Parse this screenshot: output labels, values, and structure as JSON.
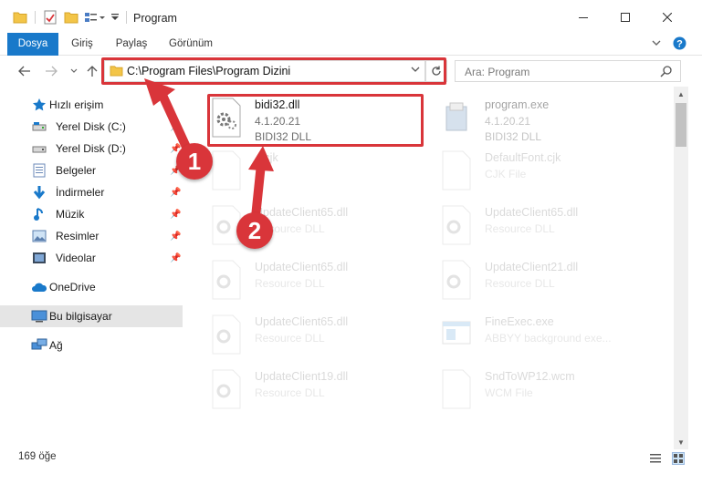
{
  "window": {
    "title": "Program",
    "minimize_label": "—",
    "maximize_label": "☐",
    "close_label": "✕"
  },
  "ribbon": {
    "tabs": [
      {
        "label": "Dosya",
        "active": true
      },
      {
        "label": "Giriş"
      },
      {
        "label": "Paylaş"
      },
      {
        "label": "Görünüm"
      }
    ]
  },
  "navigation": {
    "address": "C:\\Program Files\\Program Dizini",
    "search_placeholder": "Ara: Program"
  },
  "sidebar": {
    "items": [
      {
        "label": "Hızlı erişim",
        "icon": "star-icon"
      },
      {
        "label": "Yerel Disk (C:)",
        "icon": "drive-icon",
        "pinned": true
      },
      {
        "label": "Yerel Disk (D:)",
        "icon": "drive-icon",
        "pinned": true
      },
      {
        "label": "Belgeler",
        "icon": "document-icon",
        "pinned": true
      },
      {
        "label": "İndirmeler",
        "icon": "download-icon",
        "pinned": true
      },
      {
        "label": "Müzik",
        "icon": "music-icon",
        "pinned": true
      },
      {
        "label": "Resimler",
        "icon": "pictures-icon",
        "pinned": true
      },
      {
        "label": "Videolar",
        "icon": "video-icon",
        "pinned": true
      },
      {
        "label": "OneDrive",
        "icon": "cloud-icon"
      },
      {
        "label": "Bu bilgisayar",
        "icon": "computer-icon",
        "selected": true
      },
      {
        "label": "Ağ",
        "icon": "network-icon"
      }
    ]
  },
  "files": [
    {
      "name": "bidi32.dll",
      "line1": "4.1.20.21",
      "line2": "BIDI32 DLL",
      "icon": "dll-gear-icon",
      "highlighted": true
    },
    {
      "name": "program.exe",
      "line1": "4.1.20.21",
      "line2": "BIDI32 DLL",
      "icon": "installer-icon"
    },
    {
      "name": "...cjk",
      "line1": "",
      "line2": "",
      "icon": "blank-file-icon"
    },
    {
      "name": "DefaultFont.cjk",
      "line1": "CJK File",
      "line2": "",
      "icon": "blank-file-icon"
    },
    {
      "name": "UpdateClient65.dll",
      "line1": "Resource DLL",
      "line2": "",
      "icon": "dll-gear-icon"
    },
    {
      "name": "UpdateClient65.dll",
      "line1": "Resource DLL",
      "line2": "",
      "icon": "dll-gear-icon"
    },
    {
      "name": "UpdateClient65.dll",
      "line1": "Resource DLL",
      "line2": "",
      "icon": "dll-gear-icon"
    },
    {
      "name": "UpdateClient21.dll",
      "line1": "Resource DLL",
      "line2": "",
      "icon": "dll-gear-icon"
    },
    {
      "name": "UpdateClient65.dll",
      "line1": "Resource DLL",
      "line2": "",
      "icon": "dll-gear-icon"
    },
    {
      "name": "FineExec.exe",
      "line1": "ABBYY background exe...",
      "line2": "",
      "icon": "app-window-icon"
    },
    {
      "name": "UpdateClient19.dll",
      "line1": "Resource DLL",
      "line2": "",
      "icon": "dll-gear-icon"
    },
    {
      "name": "SndToWP12.wcm",
      "line1": "WCM File",
      "line2": "",
      "icon": "blank-file-icon"
    }
  ],
  "status": {
    "item_count": "169 öğe"
  },
  "annotations": {
    "badge1": "1",
    "badge2": "2"
  },
  "colors": {
    "accent": "#1979ca",
    "highlight_red": "#d9353a",
    "selected_bg": "#e5e5e5"
  }
}
